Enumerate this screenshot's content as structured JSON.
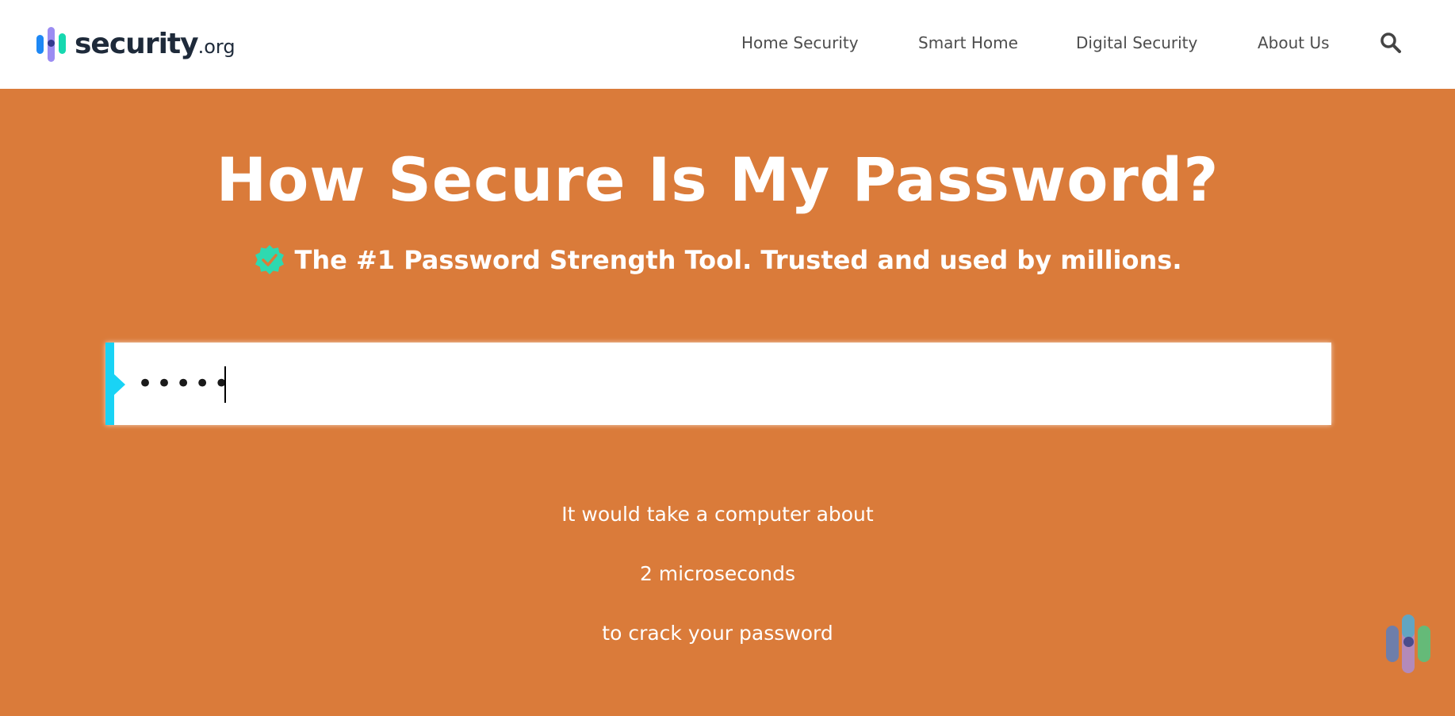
{
  "header": {
    "logo": {
      "name": "security",
      "suffix": ".org"
    },
    "nav": [
      {
        "label": "Home Security"
      },
      {
        "label": "Smart Home"
      },
      {
        "label": "Digital Security"
      },
      {
        "label": "About Us"
      }
    ],
    "search_icon": "search-icon"
  },
  "hero": {
    "title": "How Secure Is My Password?",
    "subtitle": "The #1 Password Strength Tool. Trusted and used by millions.",
    "badge_icon": "verified-check-icon"
  },
  "password_input": {
    "value": "•••••",
    "type": "password"
  },
  "result": {
    "line1": "It would take a computer about",
    "time": "2 microseconds",
    "line3": "to crack your password"
  },
  "colors": {
    "background": "#DA7B3A",
    "accent": "#19D3F5",
    "badge": "#2ED9B0",
    "text_dark": "#1E2A3A"
  },
  "widget_icon": "security-org-widget-icon"
}
